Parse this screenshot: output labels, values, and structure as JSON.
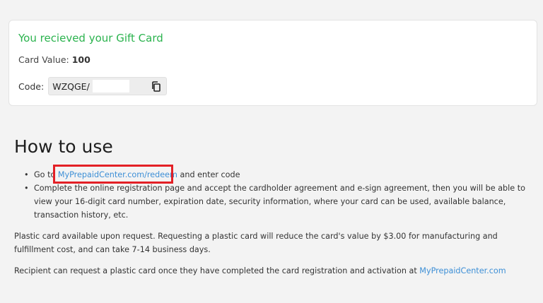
{
  "card": {
    "title": "You recieved your Gift Card",
    "value_label": "Card Value: ",
    "value": "100",
    "code_label": "Code:",
    "code": "WZQGE/",
    "copy_icon": "copy-icon"
  },
  "how_to_use": {
    "title": "How to use",
    "step1_prefix": "Go to ",
    "step1_link": "MyPrepaidCenter.com/redeem",
    "step1_suffix": " and enter code",
    "step2": "Complete the online registration page and accept the cardholder agreement and e-sign agreement, then you will be able to view your 16-digit card number, expiration date, security information, where your card can be used, available balance, transaction history, etc.",
    "bullet": "•"
  },
  "plastic_card_note": "Plastic card available upon request. Requesting a plastic card will reduce the card's value by $3.00 for manufacturing and fulfillment cost, and can take 7-14 business days.",
  "recipient_note_prefix": "Recipient can request a plastic card once they have completed the card registration and activation at ",
  "recipient_note_link": "MyPrepaidCenter.com",
  "colors": {
    "title_green": "#2bb34e",
    "link_blue": "#3d8fd6",
    "highlight_red": "#e32026"
  }
}
